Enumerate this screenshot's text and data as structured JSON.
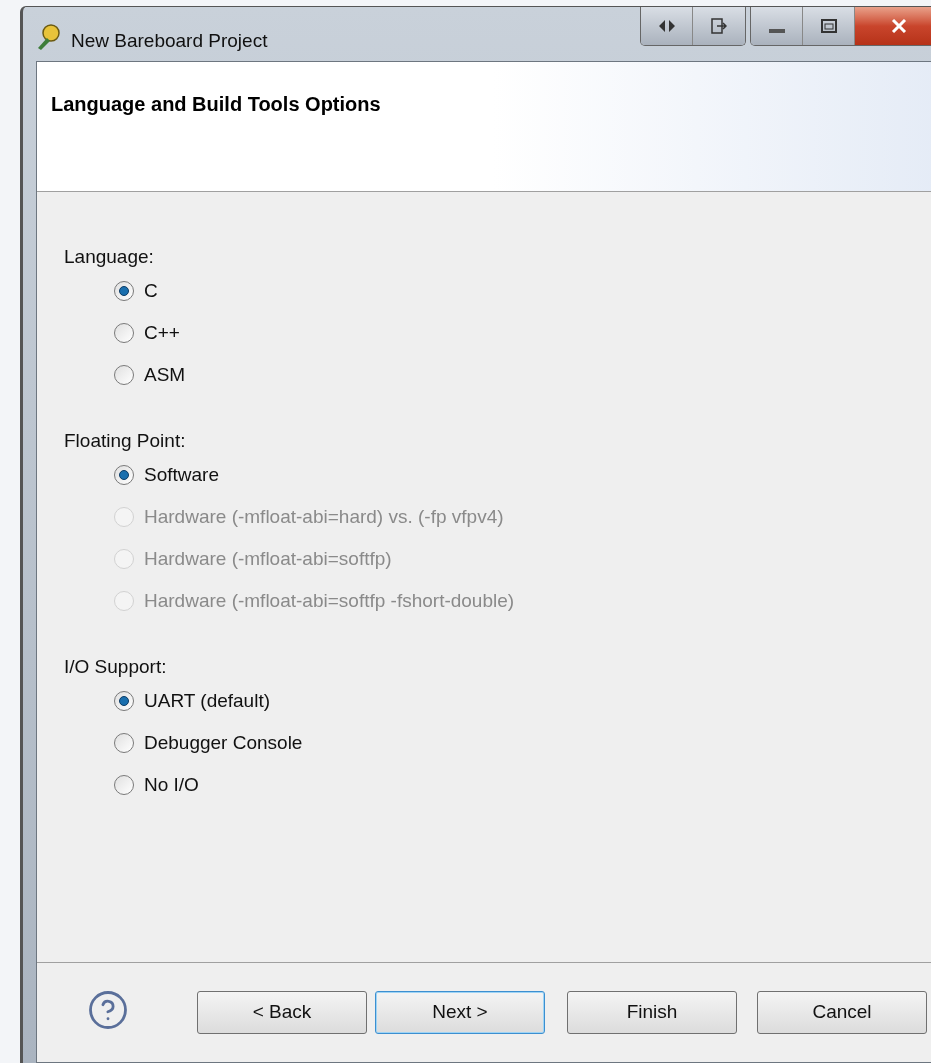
{
  "window": {
    "title": "New Bareboard Project"
  },
  "header": {
    "title": "Language and Build Tools Options"
  },
  "groups": [
    {
      "label": "Language:",
      "options": [
        {
          "label": "C",
          "selected": true,
          "disabled": false
        },
        {
          "label": "C++",
          "selected": false,
          "disabled": false
        },
        {
          "label": "ASM",
          "selected": false,
          "disabled": false
        }
      ]
    },
    {
      "label": "Floating Point:",
      "options": [
        {
          "label": "Software",
          "selected": true,
          "disabled": false
        },
        {
          "label": "Hardware (-mfloat-abi=hard) vs. (-fp vfpv4)",
          "selected": false,
          "disabled": true
        },
        {
          "label": "Hardware (-mfloat-abi=softfp)",
          "selected": false,
          "disabled": true
        },
        {
          "label": "Hardware (-mfloat-abi=softfp -fshort-double)",
          "selected": false,
          "disabled": true
        }
      ]
    },
    {
      "label": "I/O Support:",
      "options": [
        {
          "label": "UART (default)",
          "selected": true,
          "disabled": false
        },
        {
          "label": "Debugger Console",
          "selected": false,
          "disabled": false
        },
        {
          "label": "No I/O",
          "selected": false,
          "disabled": false
        }
      ]
    }
  ],
  "buttons": [
    {
      "label": "< Back",
      "default": false
    },
    {
      "label": "Next >",
      "default": true
    },
    {
      "label": "Finish",
      "default": false
    },
    {
      "label": "Cancel",
      "default": false
    }
  ]
}
